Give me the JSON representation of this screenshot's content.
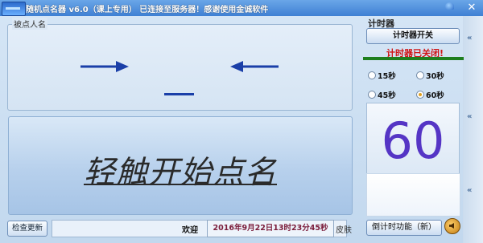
{
  "window": {
    "title": "随机点名器 v6.0（课上专用） 已连接至服务器！感谢使用金诚软件",
    "close_label": "✕"
  },
  "name_group": {
    "label": "被点人名",
    "current_name": ""
  },
  "start_button": {
    "label": "轻触开始点名"
  },
  "bottom_bar": {
    "check_update_label": "检查更新",
    "welcome_text": "欢迎",
    "datetime": "2016年9月22日13时23分45秒",
    "skin_label": "皮肤"
  },
  "timer": {
    "heading": "计时器",
    "toggle_label": "计时器开关",
    "status": "计时器已关闭!",
    "options": [
      {
        "label": "15秒",
        "selected": false
      },
      {
        "label": "30秒",
        "selected": false
      },
      {
        "label": "45秒",
        "selected": false
      },
      {
        "label": "60秒",
        "selected": true
      }
    ],
    "value": "60",
    "countdown_label": "倒计时功能（新）",
    "side_chevrons": [
      "«",
      "«",
      "«"
    ]
  },
  "colors": {
    "title_bar": "#3f80d4",
    "arrow": "#1a3fa8",
    "timer_digits": "#5535c5",
    "status_red": "#d01414",
    "status_bar_green": "#1e7f1e"
  },
  "icons": [
    "app-icon",
    "pin-icon",
    "close-icon",
    "left-arrow-icon",
    "right-arrow-icon",
    "speaker-icon",
    "chevron-left-icon"
  ]
}
